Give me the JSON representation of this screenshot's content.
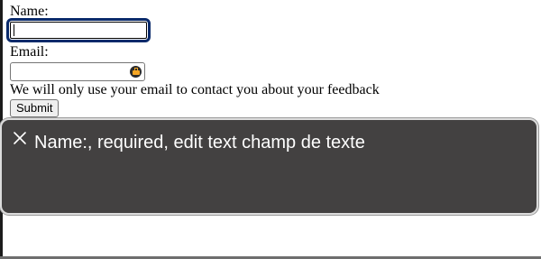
{
  "form": {
    "name_label": "Name:",
    "name_value": "",
    "email_label": "Email:",
    "email_value": "",
    "help_text": "We will only use your email to contact you about your feedback",
    "submit_label": "Submit"
  },
  "voiceover": {
    "caption": "Name:, required, edit text champ de texte",
    "close_icon": "close-icon"
  },
  "icons": {
    "email_autofill": "autofill-key-icon"
  }
}
